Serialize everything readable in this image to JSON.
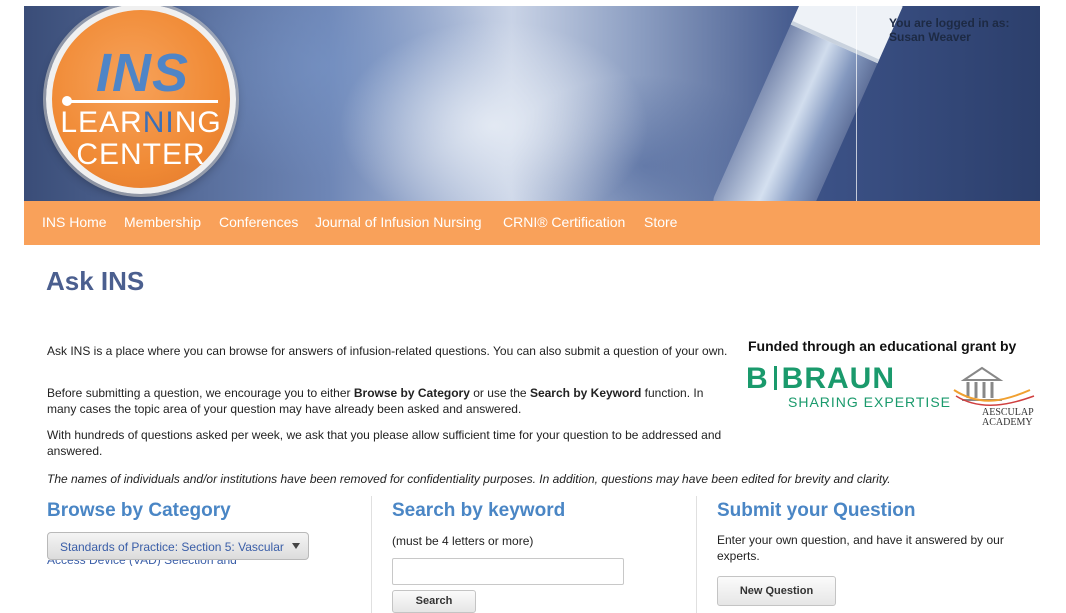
{
  "header": {
    "logo": {
      "line1": "INS",
      "line2_a": "LEAR",
      "line2_b": "NI",
      "line2_c": "NG",
      "line3": "CENTER"
    },
    "login_prefix": "You are logged in as:",
    "user_name": "Susan Weaver"
  },
  "nav": {
    "items": [
      "INS Home",
      "Membership",
      "Conferences",
      "Journal of Infusion Nursing",
      "CRNI® Certification",
      "Store"
    ]
  },
  "page": {
    "title": "Ask INS",
    "intro_1": "Ask INS is a place where you can browse for answers of infusion-related questions. You can also submit a question of your own.",
    "intro_2_pre": "Before submitting a question, we encourage you to either ",
    "intro_2_browse": "Browse by Category",
    "intro_2_mid": " or use the ",
    "intro_2_search": "Search by Keyword",
    "intro_2_post": " function. In many cases the topic area of your question may have already been asked and answered.",
    "intro_3": "With hundreds of questions asked per week, we ask that you please allow sufficient time for your question to be addressed and answered.",
    "note": "The names of individuals and/or institutions have been removed for confidentiality purposes. In addition, questions may have been edited for brevity and clarity."
  },
  "sponsor": {
    "funded_text": "Funded through an educational grant by",
    "bbraun_b": "B",
    "bbraun_name": "BRAUN",
    "bbraun_tagline": "SHARING EXPERTISE",
    "aesculap_line1": "AESCULAP",
    "aesculap_line2": "ACADEMY"
  },
  "browse": {
    "heading": "Browse by Category",
    "selected": "Standards of Practice: Section 5: Vascular",
    "peek": "Access Device (VAD) Selection and"
  },
  "search": {
    "heading": "Search by keyword",
    "hint": "(must be 4 letters or more)",
    "placeholder": "",
    "button": "Search"
  },
  "submit": {
    "heading": "Submit your Question",
    "hint": "Enter your own question, and have it answered by our experts.",
    "button": "New Question"
  },
  "colors": {
    "nav_bg": "#f9a15a",
    "title": "#4b5f8f",
    "section_heading": "#4a86c5",
    "logo_orange": "#f08a35",
    "bbraun_green": "#1a9a6c"
  }
}
